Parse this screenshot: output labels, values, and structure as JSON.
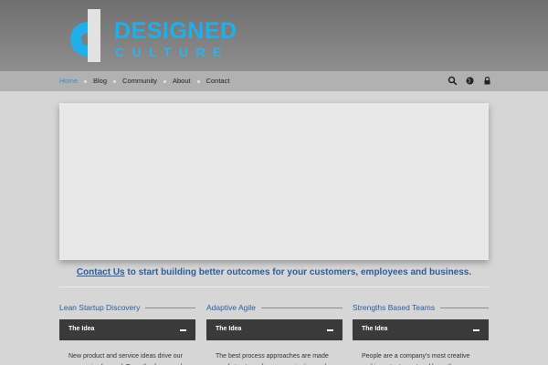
{
  "logo": {
    "title": "DESIGNED",
    "subtitle": "CULTURE"
  },
  "nav": {
    "items": [
      "Home",
      "Blog",
      "Community",
      "About",
      "Contact"
    ],
    "active": "Home"
  },
  "nav_icons": [
    "search-icon",
    "globe-icon",
    "lock-icon"
  ],
  "cta": {
    "link": "Contact Us",
    "text": " to start building better outcomes for your customers, employees and business."
  },
  "columns": [
    {
      "title": "Lean Startup Discovery",
      "accordion": "The Idea",
      "body": "New product and service ideas drive our companies forward. Empathy, focus and"
    },
    {
      "title": "Adaptive Agile",
      "accordion": "The Idea",
      "body": "The best process approaches are made up of structures for communication and"
    },
    {
      "title": "Strengths Based Teams",
      "accordion": "The Idea",
      "body": "People are a company's most creative and important asset and have the"
    }
  ],
  "colors": {
    "accent": "#1fb0ec",
    "link": "#2b5d9e",
    "accordion": "#3a3a3a"
  }
}
